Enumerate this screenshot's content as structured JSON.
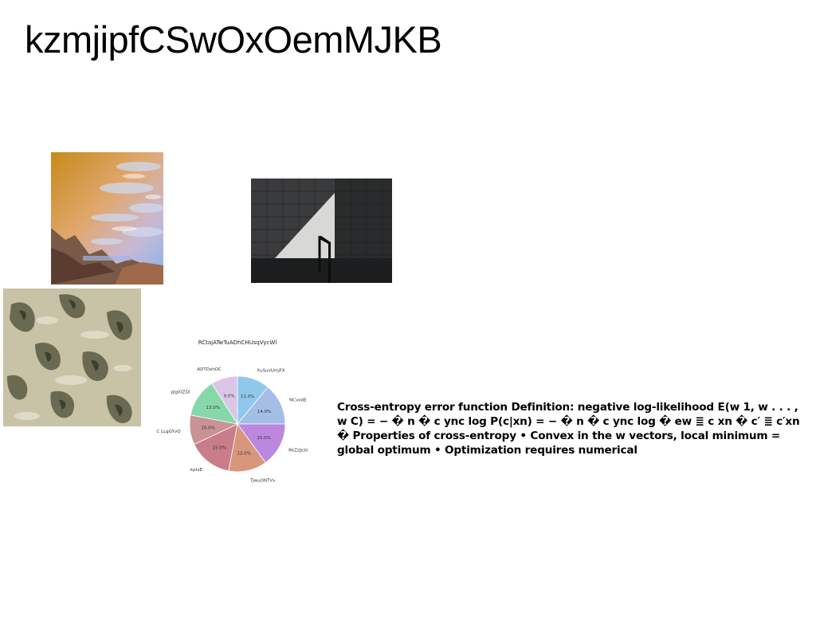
{
  "page": {
    "title": "kzmjipfCSwOxOemMJKB",
    "body_text": "Cross-entropy error function Definition: negative log-likelihood E(w 1, w . . . , w C) = − � n � c ync log P(c|xn) = − � n � c ync log � ew ≣ c xn � c′ ≣ c′xn � Properties of cross-entropy • Convex in the w vectors, local minimum = global optimum • Optimization requires numerical"
  },
  "images": [
    {
      "name": "photo-desert-sky",
      "icon": "landscape-photo"
    },
    {
      "name": "photo-stairs-shadow",
      "icon": "architecture-photo"
    },
    {
      "name": "photo-rock-texture",
      "icon": "texture-photo"
    }
  ],
  "chart_data": {
    "type": "pie",
    "title": "RCtajATwTuADhCHUsqVycWl",
    "categories": [
      "XuSuvUmjFX",
      "NCvodE",
      "RkZzJjcki",
      "TJwuDNTVv",
      "kplxE",
      "C LLgGYvQ",
      "pJgiOZQi",
      "ADTDxhOC"
    ],
    "values": [
      11.0,
      14.0,
      15.0,
      13.0,
      15.0,
      10.0,
      13.0,
      9.0
    ],
    "value_labels": [
      "11.0%",
      "14.0%",
      "15.0%",
      "13.0%",
      "15.0%",
      "10.0%",
      "13.0%",
      "9.0%"
    ],
    "colors": [
      "#8ec9ec",
      "#a4bee6",
      "#bb88dd",
      "#d8977d",
      "#c97c8a",
      "#c99294",
      "#86d8ab",
      "#dcc6e8"
    ],
    "start_angle_deg": 90,
    "direction": "clockwise"
  }
}
